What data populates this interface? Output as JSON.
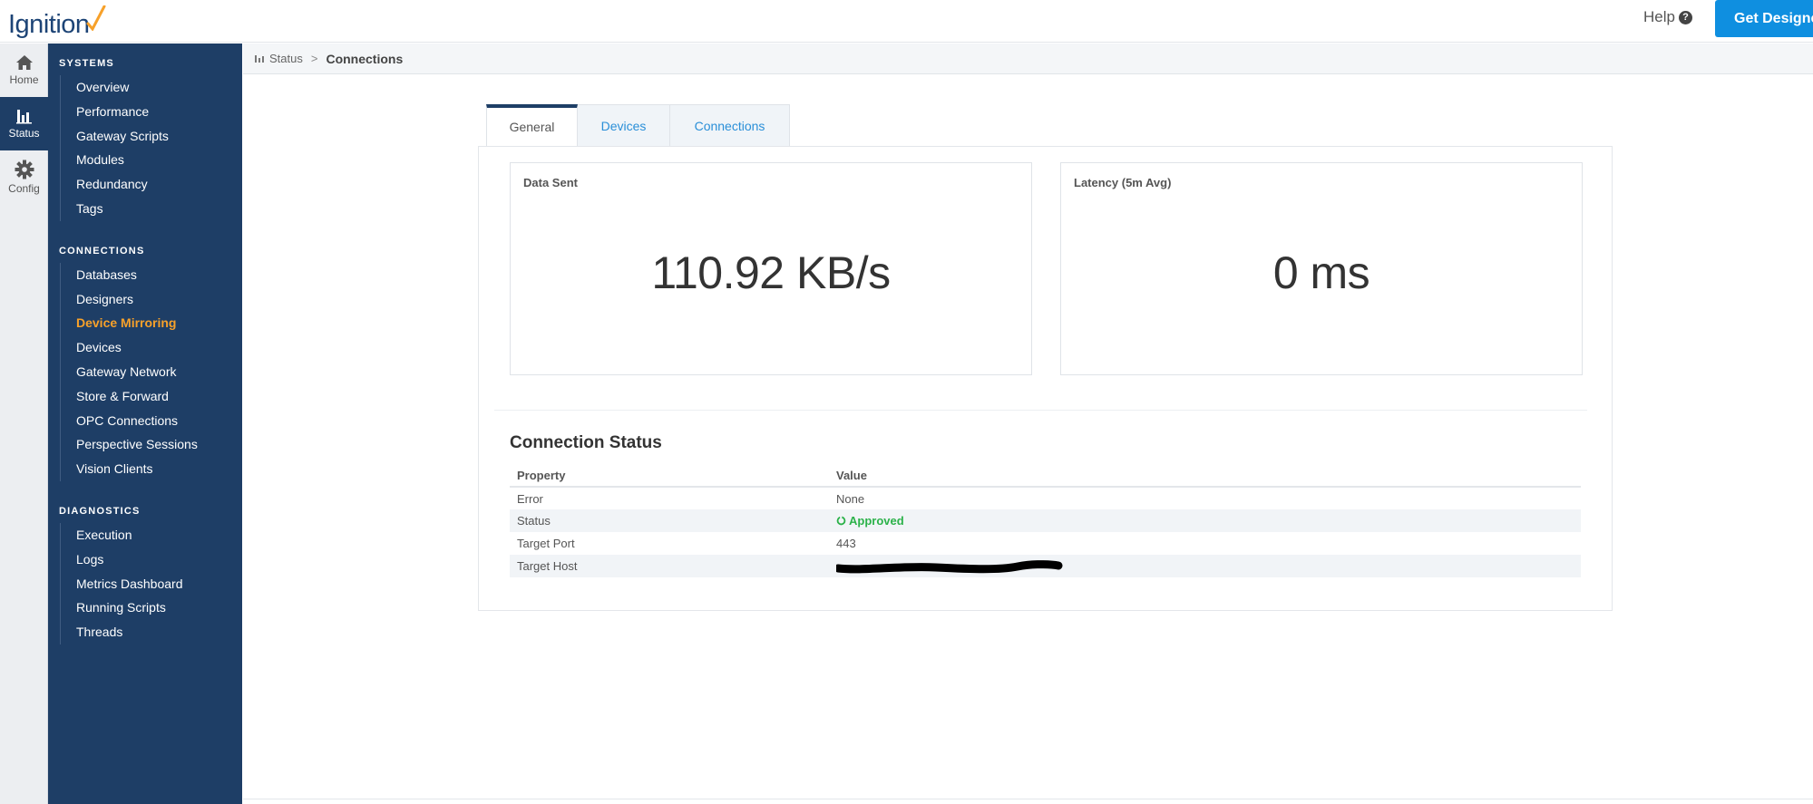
{
  "app": {
    "logo_text": "Ignition",
    "brand_accent": "#f7a12a",
    "brand_primary": "#1e3e66"
  },
  "topbar": {
    "help_label": "Help",
    "help_icon": "?",
    "get_designer_label": "Get Designer"
  },
  "rail": [
    {
      "label": "Home",
      "icon": "home-icon"
    },
    {
      "label": "Status",
      "icon": "bar-chart-icon"
    },
    {
      "label": "Config",
      "icon": "gear-icon"
    }
  ],
  "nav": {
    "systems": {
      "heading": "SYSTEMS",
      "items": [
        "Overview",
        "Performance",
        "Gateway Scripts",
        "Modules",
        "Redundancy",
        "Tags"
      ]
    },
    "connections": {
      "heading": "CONNECTIONS",
      "items": [
        "Databases",
        "Designers",
        "Device Mirroring",
        "Devices",
        "Gateway Network",
        "Store & Forward",
        "OPC Connections",
        "Perspective Sessions",
        "Vision Clients"
      ]
    },
    "diagnostics": {
      "heading": "DIAGNOSTICS",
      "items": [
        "Execution",
        "Logs",
        "Metrics Dashboard",
        "Running Scripts",
        "Threads"
      ]
    }
  },
  "breadcrumb": {
    "parent": "Status",
    "sep": ">",
    "current": "Connections"
  },
  "tabs": [
    "General",
    "Devices",
    "Connections"
  ],
  "cards": {
    "data_sent": {
      "title": "Data Sent",
      "value": "110.92 KB/s"
    },
    "latency": {
      "title": "Latency (5m Avg)",
      "value": "0 ms"
    }
  },
  "connection_status": {
    "title": "Connection Status",
    "columns": [
      "Property",
      "Value"
    ],
    "rows": [
      {
        "property": "Error",
        "value": "None"
      },
      {
        "property": "Status",
        "value": "Approved"
      },
      {
        "property": "Target Port",
        "value": "443"
      },
      {
        "property": "Target Host",
        "value": ""
      }
    ]
  }
}
